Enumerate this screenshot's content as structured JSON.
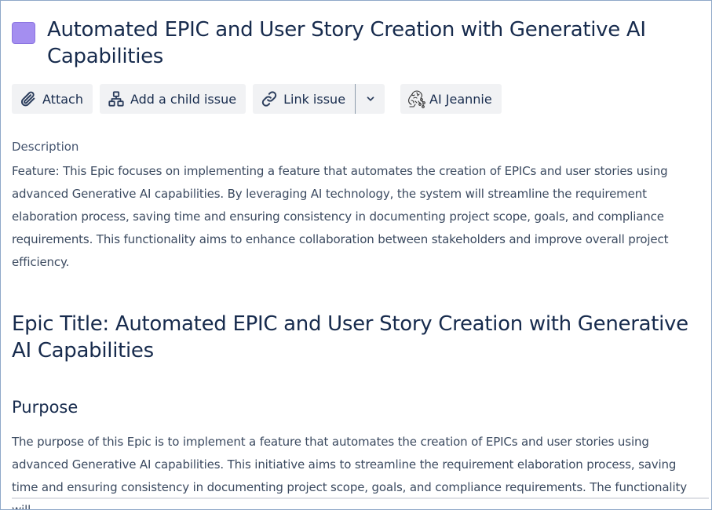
{
  "issue": {
    "type_icon": "epic-icon",
    "type_color": "#a48ef0",
    "title": "Automated EPIC and User Story Creation with Generative AI Capabilities"
  },
  "toolbar": {
    "attach_icon": "paperclip-icon",
    "attach_label": "Attach",
    "child_icon": "hierarchy-icon",
    "child_label": "Add a child issue",
    "link_icon": "link-icon",
    "link_label": "Link issue",
    "more_icon": "chevron-down-icon",
    "ai_icon": "ai-jeannie-icon",
    "ai_label": "AI Jeannie"
  },
  "description": {
    "label": "Description",
    "text": "Feature: This Epic focuses on implementing a feature that automates the creation of EPICs and user stories using advanced Generative AI capabilities. By leveraging AI technology, the system will streamline the requirement elaboration process, saving time and ensuring consistency in documenting project scope, goals, and compliance requirements. This functionality aims to enhance collaboration between stakeholders and improve overall project efficiency.",
    "heading": "Epic Title: Automated EPIC and User Story Creation with Generative AI Capabilities",
    "purpose_heading": "Purpose",
    "purpose_text": "The purpose of this Epic is to implement a feature that automates the creation of EPICs and user stories using advanced Generative AI capabilities. This initiative aims to streamline the requirement elaboration process, saving time and ensuring consistency in documenting project scope, goals, and compliance requirements. The functionality will"
  }
}
